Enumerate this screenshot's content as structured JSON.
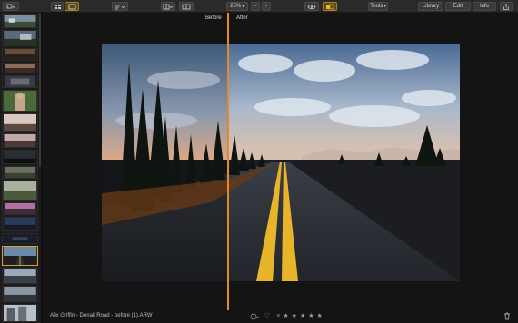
{
  "toolbar": {
    "zoom_value": "25%",
    "zoom_minus": "−",
    "zoom_plus": "+",
    "tools_label": "Tools",
    "library_label": "Library",
    "edit_label": "Edit",
    "info_label": "Info"
  },
  "compare": {
    "before_label": "Before",
    "after_label": "After"
  },
  "status": {
    "filename": "Alix Griffin - Denali Road - before (1).ARW",
    "stars": [
      "★",
      "★",
      "★",
      "★",
      "★"
    ],
    "reject_icon": "×",
    "heart_icon": "♡"
  },
  "colors": {
    "accent": "#e08a2a",
    "selected_border": "#d8a030",
    "toolbar_bg": "#2a2a2a",
    "canvas_bg": "#141414"
  }
}
